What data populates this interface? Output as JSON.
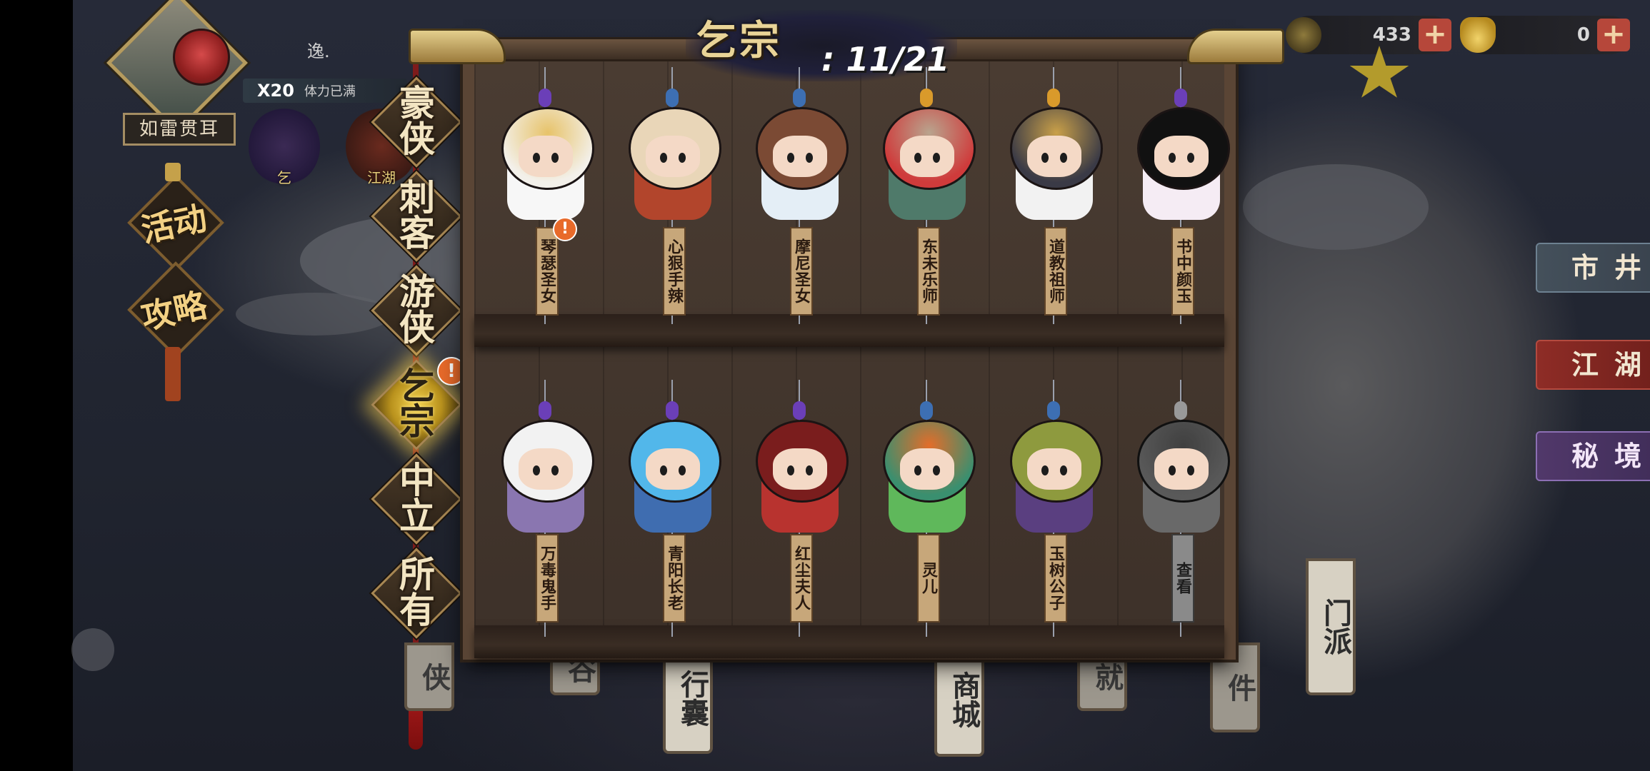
{
  "player": {
    "name": "逸.",
    "stamina_multiplier": "X20",
    "stamina_status": "体力已满",
    "title": "如雷贯耳"
  },
  "left_menu": {
    "activity": "活动",
    "guide": "攻略",
    "jianghu_mini": "江湖"
  },
  "header": {
    "faction": "乞宗",
    "separator": ":",
    "collected": "11/21"
  },
  "faction_tabs": [
    {
      "label": "豪侠",
      "active": false
    },
    {
      "label": "刺客",
      "active": false
    },
    {
      "label": "游侠",
      "active": false
    },
    {
      "label": "乞宗",
      "active": true,
      "alert": "!"
    },
    {
      "label": "中立",
      "active": false
    },
    {
      "label": "所有",
      "active": false
    }
  ],
  "characters_row1": [
    {
      "name": "琴瑟圣女",
      "alert": "!",
      "bead_color": "#6b3fb8",
      "head_color": "#f3f0ea",
      "hat_color": "#e7c36a",
      "body_color": "#f7f7f7"
    },
    {
      "name": "心狠手辣",
      "bead_color": "#3d6fb3",
      "head_color": "#e9d6b8",
      "hat_color": "#e9d6b8",
      "body_color": "#b2452c"
    },
    {
      "name": "摩尼圣女",
      "bead_color": "#3d6fb3",
      "head_color": "#7b4a34",
      "hat_color": "#7b4a34",
      "body_color": "#e4eef6"
    },
    {
      "name": "东未乐师",
      "bead_color": "#d99a2b",
      "head_color": "#cf3b3b",
      "hat_color": "#b9a48e",
      "body_color": "#4f7a6a"
    },
    {
      "name": "道教祖师",
      "bead_color": "#d99a2b",
      "head_color": "#3a3a46",
      "hat_color": "#c9a049",
      "body_color": "#f2f2f2"
    },
    {
      "name": "书中颜玉",
      "bead_color": "#6b3fb8",
      "head_color": "#111111",
      "hat_color": "#111111",
      "body_color": "#f5ecf4"
    }
  ],
  "characters_row2": [
    {
      "name": "万毒鬼手",
      "locked": false,
      "bead_color": "#6b3fb8",
      "head_color": "#f2f2f2",
      "hat_color": "#f2f2f2",
      "body_color": "#8a76b0"
    },
    {
      "name": "青阳长老",
      "locked": false,
      "bead_color": "#6b3fb8",
      "head_color": "#52b7ea",
      "hat_color": "#52b7ea",
      "body_color": "#3f6db0"
    },
    {
      "name": "红尘夫人",
      "locked": false,
      "bead_color": "#6b3fb8",
      "head_color": "#7a1d1d",
      "hat_color": "#7a1d1d",
      "body_color": "#b8332f"
    },
    {
      "name": "灵儿",
      "locked": false,
      "bead_color": "#3d6fb3",
      "head_color": "#3a8f6f",
      "hat_color": "#e36d2a",
      "body_color": "#5fb85b"
    },
    {
      "name": "玉树公子",
      "locked": false,
      "bead_color": "#3d6fb3",
      "head_color": "#8e9a3e",
      "hat_color": "#8e9a3e",
      "body_color": "#5a3f80"
    },
    {
      "name": "查看",
      "locked": true,
      "bead_color": "#999999",
      "head_color": "#777777",
      "hat_color": "#555555",
      "body_color": "#8c8c8c"
    }
  ],
  "currencies": [
    {
      "icon": "leaf-icon",
      "value": "433",
      "color": "#6a5a2e"
    },
    {
      "icon": "gold-ingot-icon",
      "value": "0",
      "color": "#d8b548"
    }
  ],
  "right_nav": {
    "market": "市井",
    "jianghu": "江湖",
    "secret_realm": "秘境"
  },
  "bottom_signs": {
    "sect": "门派",
    "bag": "行囊",
    "shop": "商城",
    "event": "件",
    "achievement": "就",
    "hero": "侠",
    "valley": "谷"
  }
}
